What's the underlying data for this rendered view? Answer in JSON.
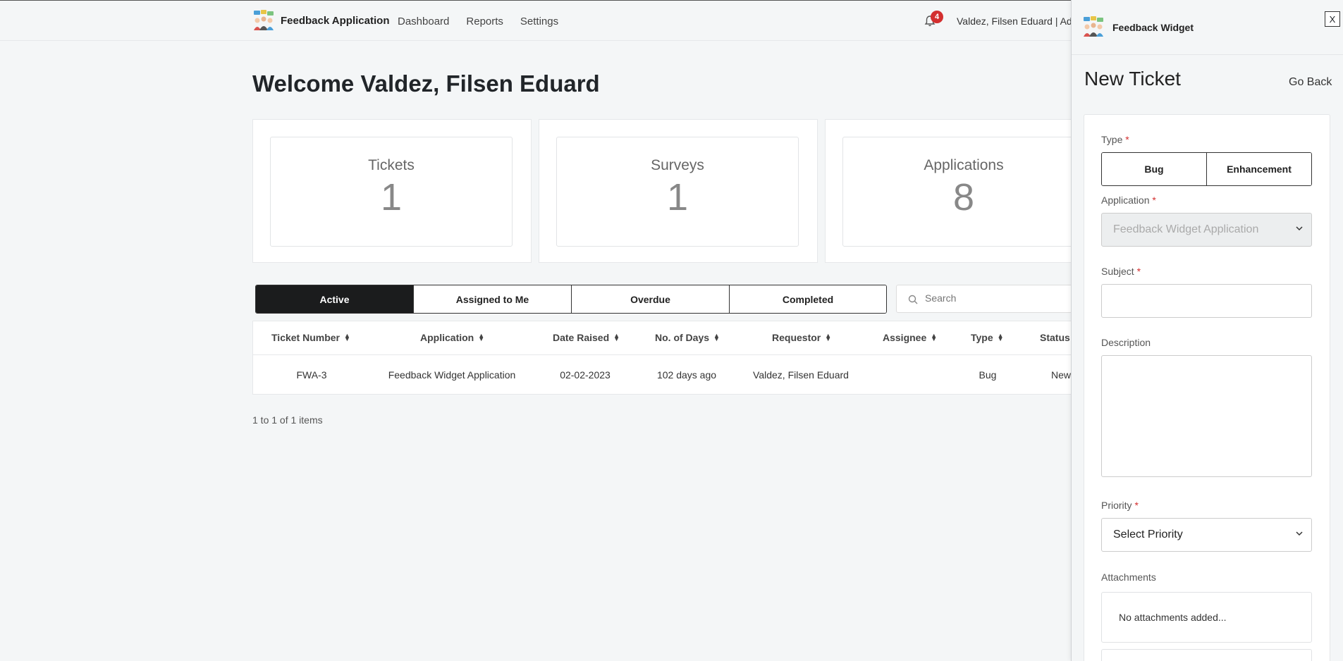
{
  "nav": {
    "brand": "Feedback Application",
    "links": [
      "Dashboard",
      "Reports",
      "Settings"
    ],
    "notification_count": "4",
    "user": "Valdez, Filsen Eduard | Admin"
  },
  "main": {
    "welcome": "Welcome Valdez, Filsen Eduard",
    "stats": [
      {
        "title": "Tickets",
        "value": "1"
      },
      {
        "title": "Surveys",
        "value": "1"
      },
      {
        "title": "Applications",
        "value": "8"
      }
    ],
    "tabs": [
      "Active",
      "Assigned to Me",
      "Overdue",
      "Completed"
    ],
    "active_tab": "Active",
    "search_placeholder": "Search",
    "table": {
      "headers": [
        "Ticket Number",
        "Application",
        "Date Raised",
        "No. of Days",
        "Requestor",
        "Assignee",
        "Type",
        "Status"
      ],
      "rows": [
        [
          "FWA-3",
          "Feedback Widget Application",
          "02-02-2023",
          "102 days ago",
          "Valdez, Filsen Eduard",
          "",
          "Bug",
          "New"
        ]
      ]
    },
    "pagination": "1 to 1 of 1 items"
  },
  "panel": {
    "title": "Feedback Widget",
    "close_label": "X",
    "form_title": "New Ticket",
    "go_back": "Go Back",
    "type_label": "Type",
    "type_options": [
      "Bug",
      "Enhancement"
    ],
    "application_label": "Application",
    "application_value": "Feedback Widget Application",
    "subject_label": "Subject",
    "subject_value": "",
    "description_label": "Description",
    "description_value": "",
    "priority_label": "Priority",
    "priority_value": "Select Priority",
    "attachments_label": "Attachments",
    "attachments_empty": "No attachments added...",
    "required_mark": "*"
  },
  "colors": {
    "active_tab_bg": "#1b1c1d",
    "badge": "#d32f2f",
    "required": "#d32f2f"
  }
}
